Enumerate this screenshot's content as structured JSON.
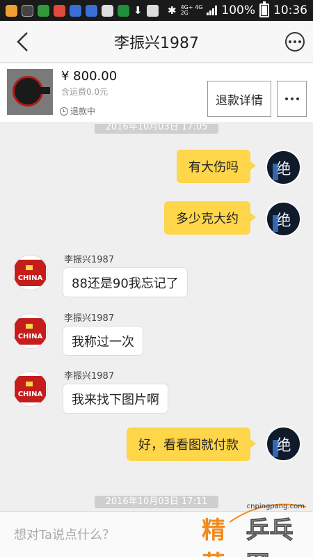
{
  "status_bar": {
    "network_label": "4G+ 4G",
    "network_sub": "2G",
    "battery": "100%",
    "time": "10:36"
  },
  "header": {
    "title": "李振兴1987"
  },
  "product": {
    "price": "¥ 800.00",
    "shipping": "含运费0.0元",
    "status": "退款中",
    "refund_button": "退款详情"
  },
  "chat": {
    "timestamp_1": "2016年10月03日 17:05",
    "timestamp_2": "2016年10月03日 17:11",
    "sender_name": "李振兴1987",
    "messages": [
      {
        "from": "me",
        "text": "有大伤吗"
      },
      {
        "from": "me",
        "text": "多少克大约"
      },
      {
        "from": "them",
        "text": "88还是90我忘记了"
      },
      {
        "from": "them",
        "text": "我称过一次"
      },
      {
        "from": "them",
        "text": "我来找下图片啊"
      },
      {
        "from": "me",
        "text": "好，看看图就付款"
      }
    ],
    "my_avatar_text": "绝",
    "their_avatar_text": "CHINA"
  },
  "input": {
    "placeholder": "想对Ta说点什么？"
  },
  "watermark": {
    "url": "cnpingpang.com",
    "logo_left": "精英",
    "logo_right": "乒乓网"
  },
  "colors": {
    "outgoing_bubble": "#ffd54a",
    "incoming_bubble": "#ffffff",
    "header_bg": "#f7f7f7"
  }
}
